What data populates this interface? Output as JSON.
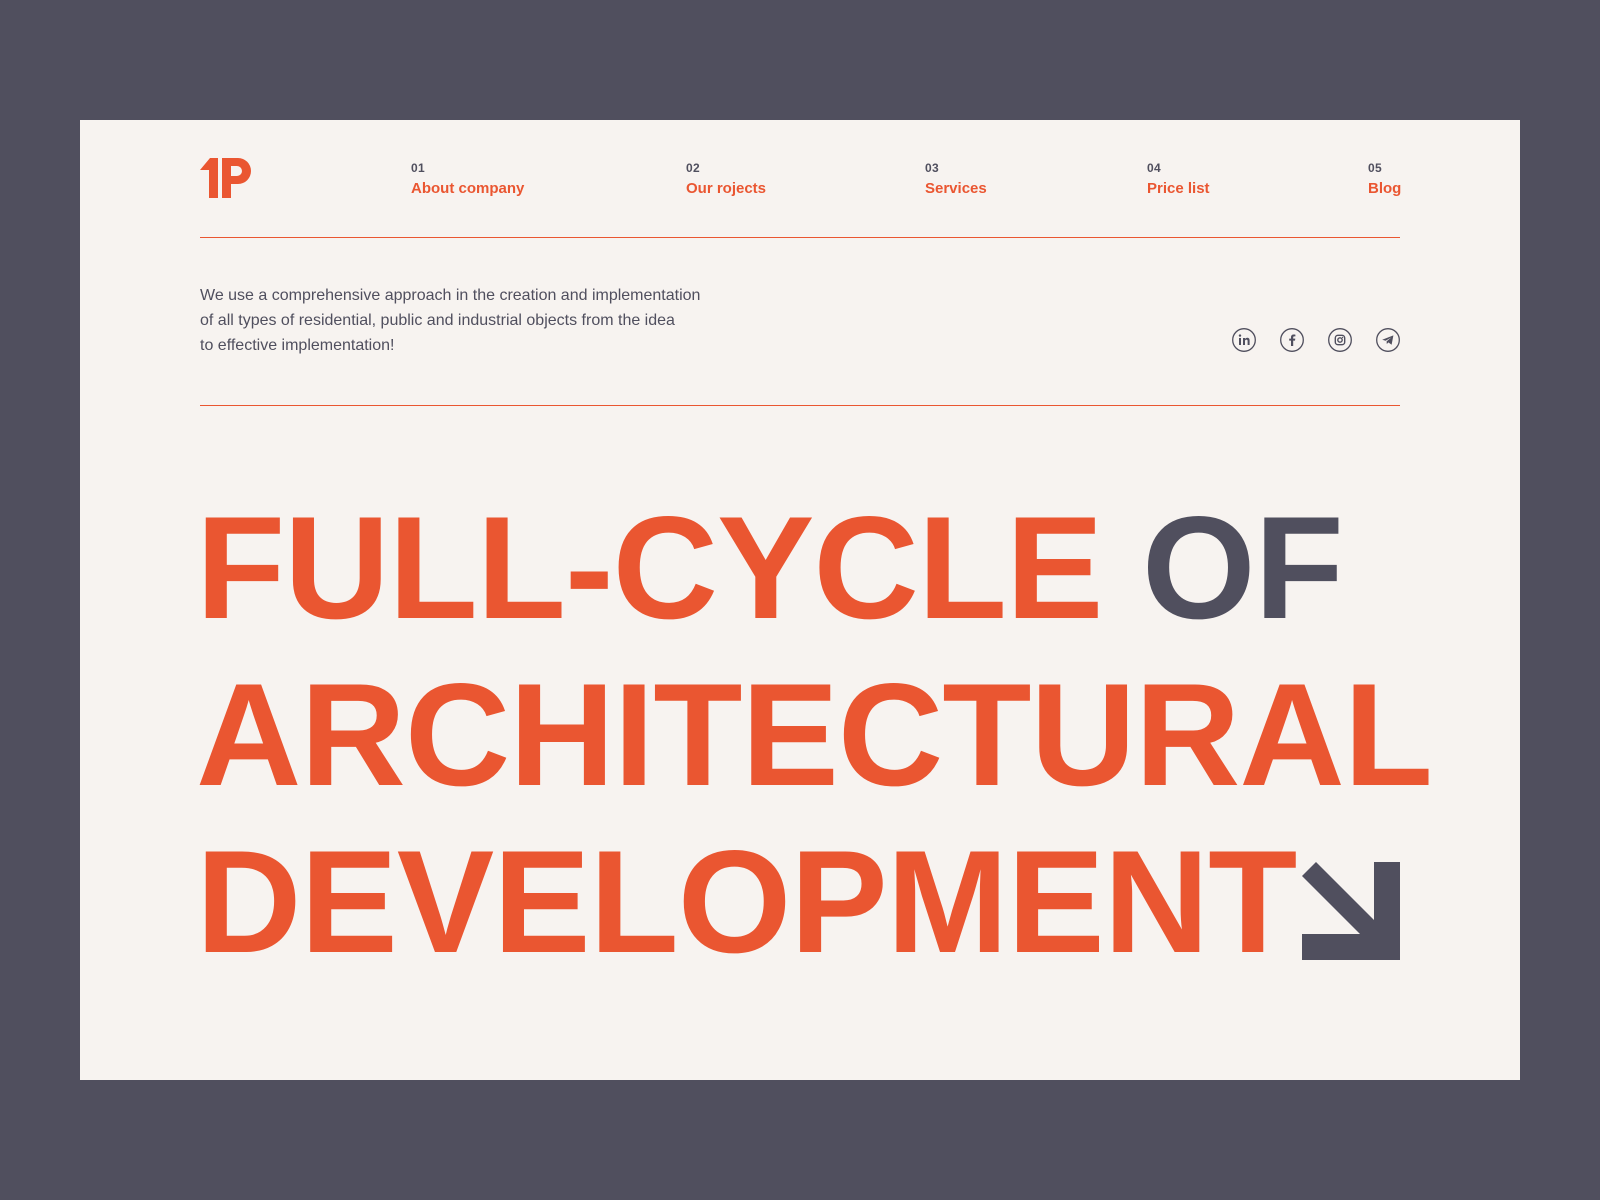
{
  "colors": {
    "accent": "#ea5631",
    "dark": "#504f5e",
    "paper": "#f7f3f0",
    "backdrop": "#504f5e"
  },
  "logo": {
    "text": "1P"
  },
  "nav": [
    {
      "num": "01",
      "label": "About company"
    },
    {
      "num": "02",
      "label": "Our rojects"
    },
    {
      "num": "03",
      "label": "Services"
    },
    {
      "num": "04",
      "label": "Price list"
    },
    {
      "num": "05",
      "label": "Blog"
    }
  ],
  "intro": {
    "line1": "We use a comprehensive approach in the creation and implementation",
    "line2": "of all types of residential, public and industrial objects from the idea",
    "line3": "to effective implementation!"
  },
  "social": [
    {
      "icon": "linkedin-icon"
    },
    {
      "icon": "facebook-icon"
    },
    {
      "icon": "instagram-icon"
    },
    {
      "icon": "telegram-icon"
    }
  ],
  "hero": {
    "line1_accent": "FULL-CYCLE",
    "line1_dark": "OF",
    "line2": "ARCHITECTURAL",
    "line3": "DEVELOPMENT"
  },
  "cta_icon": "arrow-down-right-icon"
}
